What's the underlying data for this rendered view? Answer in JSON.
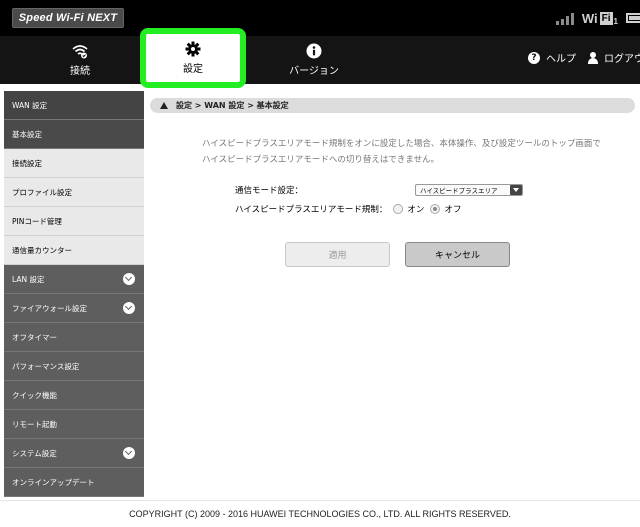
{
  "header": {
    "brand": "Speed Wi-Fi NEXT",
    "wifi_label": "WiFi",
    "wifi_badge": "Fi",
    "wifi_sub": "1",
    "wifi_prefix": "Wi"
  },
  "nav": {
    "items": [
      {
        "label": "接続",
        "icon": "wifi-connect-icon"
      },
      {
        "label": "設定",
        "icon": "gear-icon"
      },
      {
        "label": "バージョン",
        "icon": "info-icon"
      }
    ],
    "help": "ヘルプ",
    "logout": "ログアウ"
  },
  "sidebar": {
    "items": [
      {
        "label": "WAN 設定",
        "type": "category",
        "active": true
      },
      {
        "label": "基本設定",
        "type": "category-selected"
      },
      {
        "label": "接続設定",
        "type": "sub"
      },
      {
        "label": "プロファイル設定",
        "type": "sub"
      },
      {
        "label": "PINコード管理",
        "type": "sub"
      },
      {
        "label": "通信量カウンター",
        "type": "sub"
      },
      {
        "label": "LAN 設定",
        "type": "category",
        "expandable": true
      },
      {
        "label": "ファイアウォール設定",
        "type": "category",
        "expandable": true
      },
      {
        "label": "オフタイマー",
        "type": "category"
      },
      {
        "label": "パフォーマンス設定",
        "type": "category"
      },
      {
        "label": "クイック機能",
        "type": "category"
      },
      {
        "label": "リモート起動",
        "type": "category"
      },
      {
        "label": "システム設定",
        "type": "category",
        "expandable": true
      },
      {
        "label": "オンラインアップデート",
        "type": "category"
      }
    ]
  },
  "main": {
    "breadcrumb": "設定 > WAN 設定 > 基本設定",
    "description": "ハイスピードプラスエリアモード規制をオンに設定した場合、本体操作、及び設定ツールのトップ画面でハイスピードプラスエリアモードへの切り替えはできません。",
    "mode_label": "通信モード設定：",
    "mode_value": "ハイスピードプラスエリア",
    "restrict_label": "ハイスピードプラスエリアモード規制：",
    "radio_on": "オン",
    "radio_off": "オフ",
    "restrict_selected": "オフ",
    "apply": "適用",
    "cancel": "キャンセル"
  },
  "footer": {
    "copyright": "COPYRIGHT (C) 2009 - 2016 HUAWEI TECHNOLOGIES CO., LTD. ALL RIGHTS RESERVED."
  },
  "colors": {
    "highlight": "#22ee22",
    "topbar": "#000000",
    "navbar": "#141414",
    "sidebar_category": "#5e5e5e"
  }
}
